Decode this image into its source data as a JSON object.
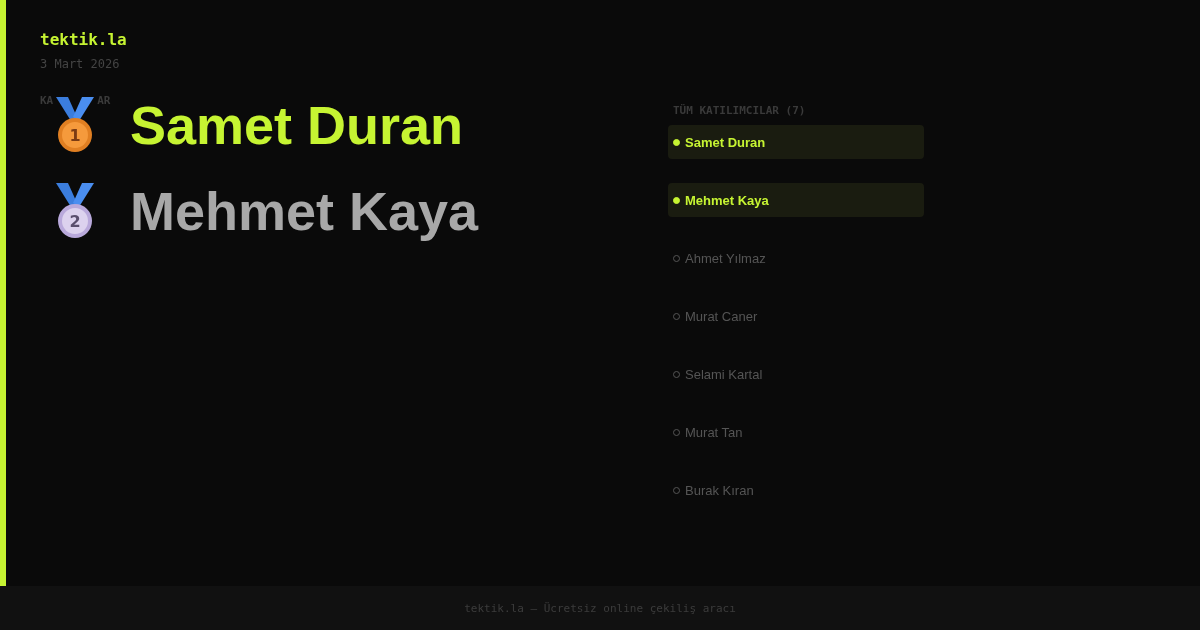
{
  "brand": "tektik.la",
  "date": "3 Mart 2026",
  "winners_label": [
    "KA",
    "AR"
  ],
  "winners": [
    {
      "rank": "1",
      "name": "Samet Duran"
    },
    {
      "rank": "2",
      "name": "Mehmet Kaya"
    }
  ],
  "participants_title": "TÜM KATILIMCILAR (7)",
  "participants": [
    {
      "name": "Samet Duran",
      "selected": true
    },
    {
      "name": "Mehmet Kaya",
      "selected": true
    },
    {
      "name": "Ahmet Yılmaz",
      "selected": false
    },
    {
      "name": "Murat Caner",
      "selected": false
    },
    {
      "name": "Selami Kartal",
      "selected": false
    },
    {
      "name": "Murat Tan",
      "selected": false
    },
    {
      "name": "Burak Kıran",
      "selected": false
    }
  ],
  "footer": "tektik.la — Ücretsiz online çekiliş aracı"
}
